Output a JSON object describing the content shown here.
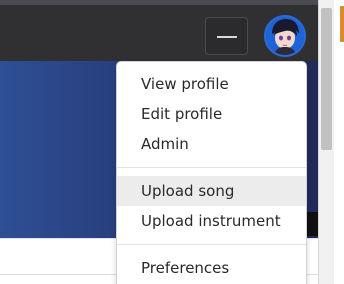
{
  "header": {
    "menu_toggle_icon": "hamburger-icon",
    "avatar_icon": "user-avatar-icon"
  },
  "dropdown": {
    "sections": [
      [
        "View profile",
        "Edit profile",
        "Admin"
      ],
      [
        "Upload song",
        "Upload instrument"
      ],
      [
        "Preferences"
      ]
    ],
    "highlighted_item": "Upload song"
  },
  "colors": {
    "header_bg": "#303033",
    "banner_start": "#2e4f96",
    "banner_end": "#212b5a",
    "menu_highlight": "#ececec"
  }
}
